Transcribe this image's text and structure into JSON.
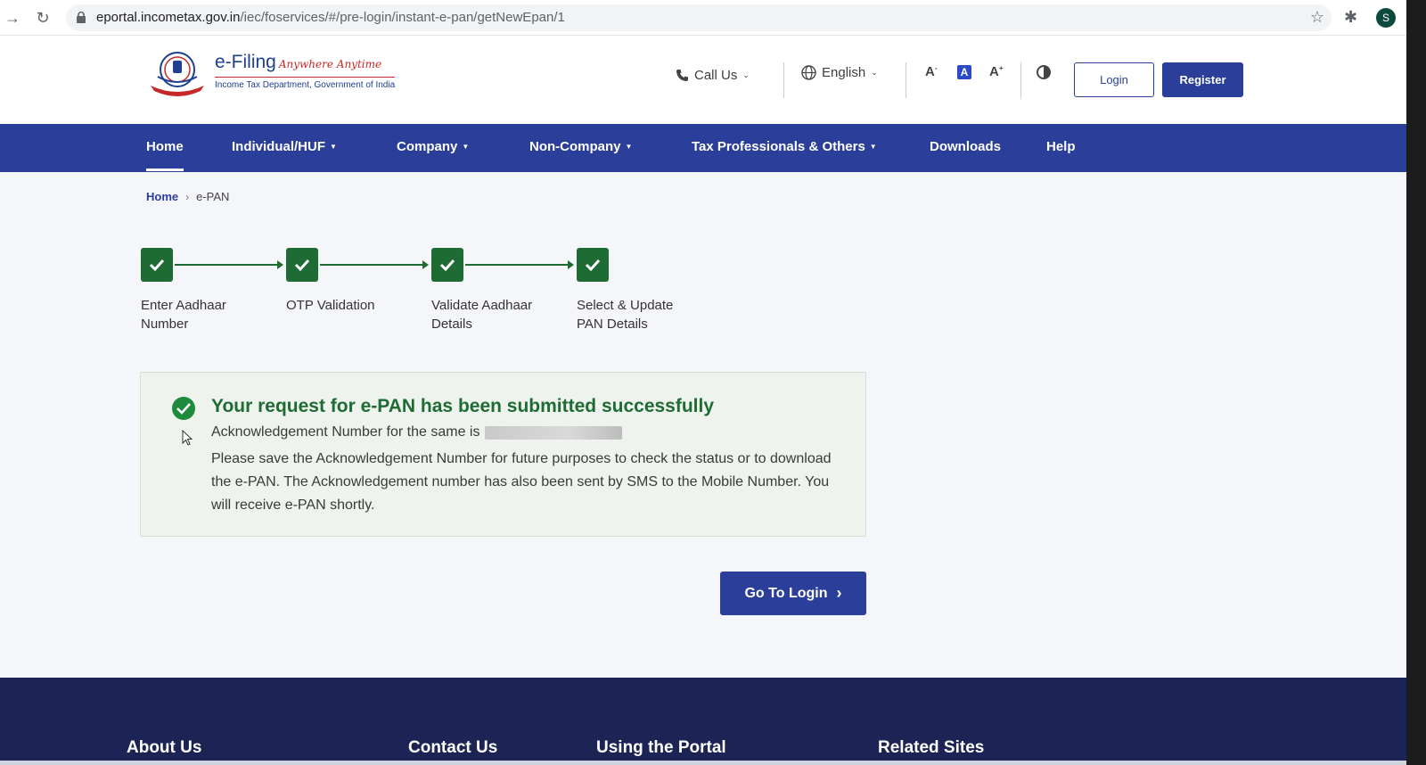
{
  "browser": {
    "url_host": "eportal.incometax.gov.in",
    "url_path": "/iec/foservices/#/pre-login/instant-e-pan/getNewEpan/1",
    "profile_initial": "S"
  },
  "logo": {
    "title": "e-Filing",
    "tagline": "Anywhere Anytime",
    "subtitle": "Income Tax Department, Government of India"
  },
  "header": {
    "call_us": "Call Us",
    "language": "English",
    "font_decrease": "A",
    "font_reset": "A",
    "font_increase": "A",
    "login_label": "Login",
    "register_label": "Register"
  },
  "nav": {
    "home": "Home",
    "individual": "Individual/HUF",
    "company": "Company",
    "non_company": "Non-Company",
    "tax_professionals": "Tax Professionals & Others",
    "downloads": "Downloads",
    "help": "Help"
  },
  "breadcrumb": {
    "home": "Home",
    "current": "e-PAN"
  },
  "steps": [
    {
      "label": "Enter Aadhaar Number"
    },
    {
      "label": "OTP Validation"
    },
    {
      "label": "Validate Aadhaar Details"
    },
    {
      "label": "Select & Update PAN Details"
    }
  ],
  "success": {
    "title": "Your request for e-PAN has been submitted successfully",
    "ack_prefix": "Acknowledgement Number for the same is",
    "body": "Please save the Acknowledgement Number for future purposes to check the status or to download the e-PAN. The Acknowledgement number has also been sent by SMS to the Mobile Number. You will receive e-PAN shortly."
  },
  "go_to_login_label": "Go To Login",
  "footer": {
    "about": "About Us",
    "contact": "Contact Us",
    "using_portal": "Using the Portal",
    "related_sites": "Related Sites"
  },
  "colors": {
    "primary": "#2b3f9a",
    "success": "#1e6b34",
    "footer": "#1b2454"
  }
}
